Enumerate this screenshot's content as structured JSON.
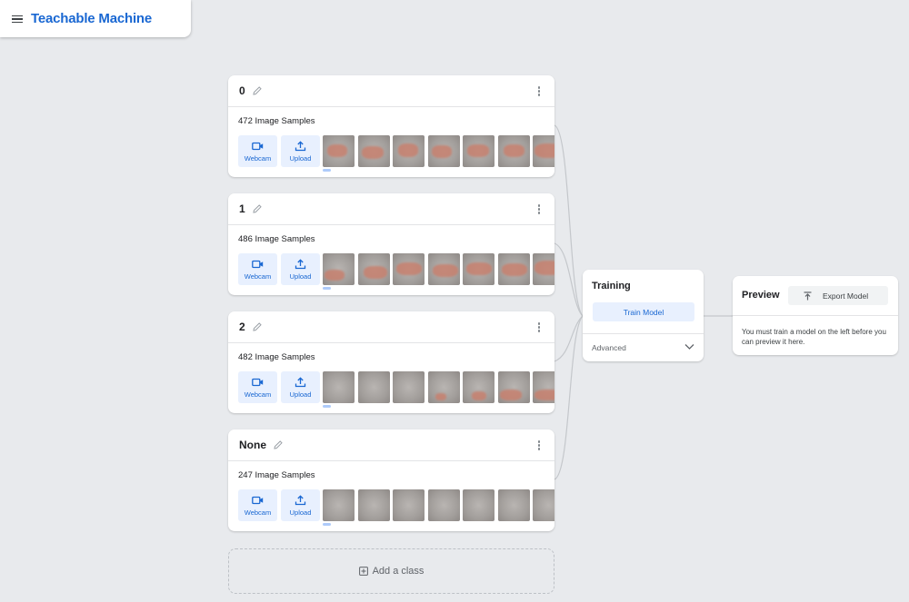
{
  "app": {
    "title": "Teachable Machine"
  },
  "classes": [
    {
      "name": "0",
      "samples": "472 Image Samples",
      "webcam_label": "Webcam",
      "upload_label": "Upload"
    },
    {
      "name": "1",
      "samples": "486 Image Samples",
      "webcam_label": "Webcam",
      "upload_label": "Upload"
    },
    {
      "name": "2",
      "samples": "482 Image Samples",
      "webcam_label": "Webcam",
      "upload_label": "Upload"
    },
    {
      "name": "None",
      "samples": "247 Image Samples",
      "webcam_label": "Webcam",
      "upload_label": "Upload"
    }
  ],
  "add_class": {
    "label": "Add a class"
  },
  "training": {
    "title": "Training",
    "train_button": "Train Model",
    "advanced_label": "Advanced"
  },
  "preview": {
    "title": "Preview",
    "export_button": "Export Model",
    "message": "You must train a model on the left before you can preview it here."
  },
  "colors": {
    "brand": "#1967d2",
    "button_bg": "#e8f0fe",
    "page_bg": "#e8eaed"
  },
  "icons": {
    "menu": "menu-icon",
    "edit": "pencil-icon",
    "more": "more-vert-icon",
    "webcam": "video-camera-icon",
    "upload": "upload-icon",
    "add": "add-box-icon",
    "expand": "chevron-down-icon",
    "export": "export-icon"
  }
}
